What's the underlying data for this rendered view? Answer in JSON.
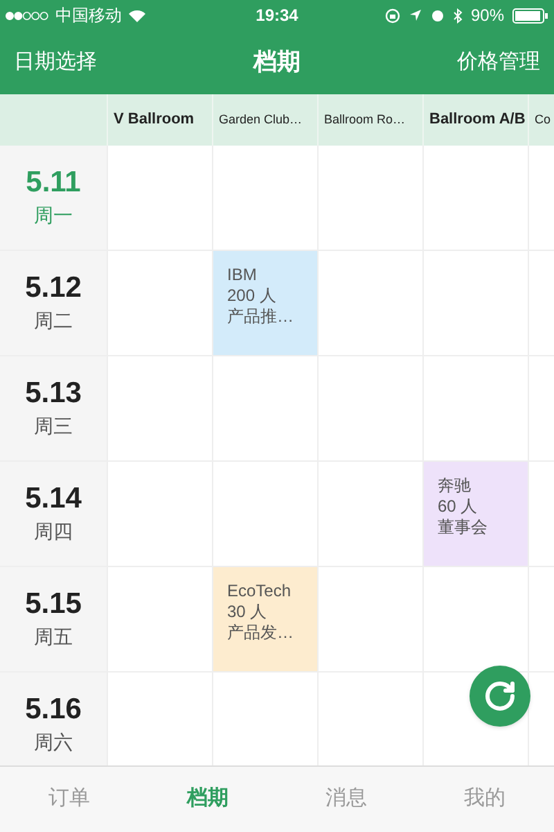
{
  "status_bar": {
    "carrier": "中国移动",
    "time": "19:34",
    "battery": "90%"
  },
  "nav": {
    "left": "日期选择",
    "title": "档期",
    "right": "价格管理"
  },
  "columns": [
    "V Ballroom",
    "Garden Club…",
    "Ballroom Ro…",
    "Ballroom A/B",
    "Co"
  ],
  "rows": [
    {
      "date": "5.11",
      "weekday": "周一",
      "today": true,
      "cells": [
        {
          "kind": "empty"
        },
        {
          "kind": "empty"
        },
        {
          "kind": "empty"
        },
        {
          "kind": "empty"
        },
        {
          "kind": "empty"
        }
      ]
    },
    {
      "date": "5.12",
      "weekday": "周二",
      "today": false,
      "cells": [
        {
          "kind": "empty"
        },
        {
          "kind": "booking",
          "client": "IBM",
          "people": "200 人",
          "topic": "产品推…",
          "color": "#d3ebfa"
        },
        {
          "kind": "empty"
        },
        {
          "kind": "empty"
        },
        {
          "kind": "empty"
        }
      ]
    },
    {
      "date": "5.13",
      "weekday": "周三",
      "today": false,
      "cells": [
        {
          "kind": "empty"
        },
        {
          "kind": "empty"
        },
        {
          "kind": "empty"
        },
        {
          "kind": "empty"
        },
        {
          "kind": "empty"
        }
      ]
    },
    {
      "date": "5.14",
      "weekday": "周四",
      "today": false,
      "cells": [
        {
          "kind": "empty"
        },
        {
          "kind": "empty"
        },
        {
          "kind": "empty"
        },
        {
          "kind": "booking",
          "client": "奔驰",
          "people": "60 人",
          "topic": "董事会",
          "color": "#eee2fa"
        },
        {
          "kind": "empty"
        }
      ]
    },
    {
      "date": "5.15",
      "weekday": "周五",
      "today": false,
      "cells": [
        {
          "kind": "empty"
        },
        {
          "kind": "booking",
          "client": "EcoTech",
          "people": "30 人",
          "topic": "产品发…",
          "color": "#fdeccf"
        },
        {
          "kind": "empty"
        },
        {
          "kind": "empty"
        },
        {
          "kind": "empty"
        }
      ]
    },
    {
      "date": "5.16",
      "weekday": "周六",
      "today": false,
      "cells": [
        {
          "kind": "empty"
        },
        {
          "kind": "empty"
        },
        {
          "kind": "empty"
        },
        {
          "kind": "empty"
        },
        {
          "kind": "empty"
        }
      ]
    }
  ],
  "tabs": [
    {
      "label": "订单",
      "selected": false
    },
    {
      "label": "档期",
      "selected": true
    },
    {
      "label": "消息",
      "selected": false
    },
    {
      "label": "我的",
      "selected": false
    }
  ]
}
